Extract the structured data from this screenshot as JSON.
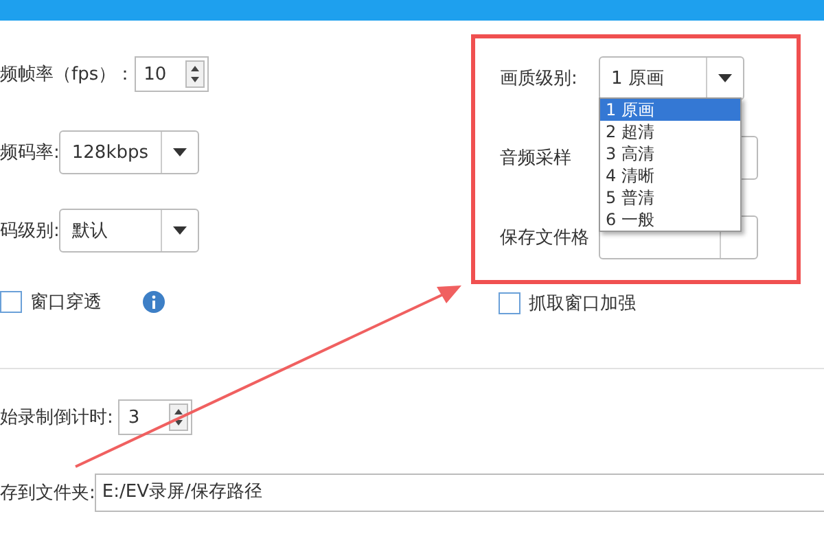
{
  "left_settings": [
    {
      "kind": "spinner",
      "label": "频帧率（fps）：",
      "value": "10"
    },
    {
      "kind": "select",
      "label": "频码率:",
      "value": "128kbps"
    },
    {
      "kind": "select",
      "label": "码级别:",
      "value": "默认"
    }
  ],
  "window_passthrough": {
    "label": "窗口穿透",
    "checked": false
  },
  "quality": {
    "label": "画质级别:",
    "value": "1 原画",
    "expanded": true,
    "options": [
      {
        "label": "1 原画",
        "selected": true
      },
      {
        "label": "2 超清",
        "selected": false
      },
      {
        "label": "3 高清",
        "selected": false
      },
      {
        "label": "4 清晰",
        "selected": false
      },
      {
        "label": "5 普清",
        "selected": false
      },
      {
        "label": "6 一般",
        "selected": false
      }
    ]
  },
  "right_settings": [
    {
      "label": "音频采样"
    },
    {
      "label": "保存文件格"
    }
  ],
  "capture_enhance": {
    "label": "抓取窗口加强",
    "checked": false
  },
  "countdown": {
    "label": "始录制倒计时:",
    "value": "3"
  },
  "save_folder": {
    "label": "存到文件夹:",
    "value": "E:/EV录屏/保存路径"
  }
}
